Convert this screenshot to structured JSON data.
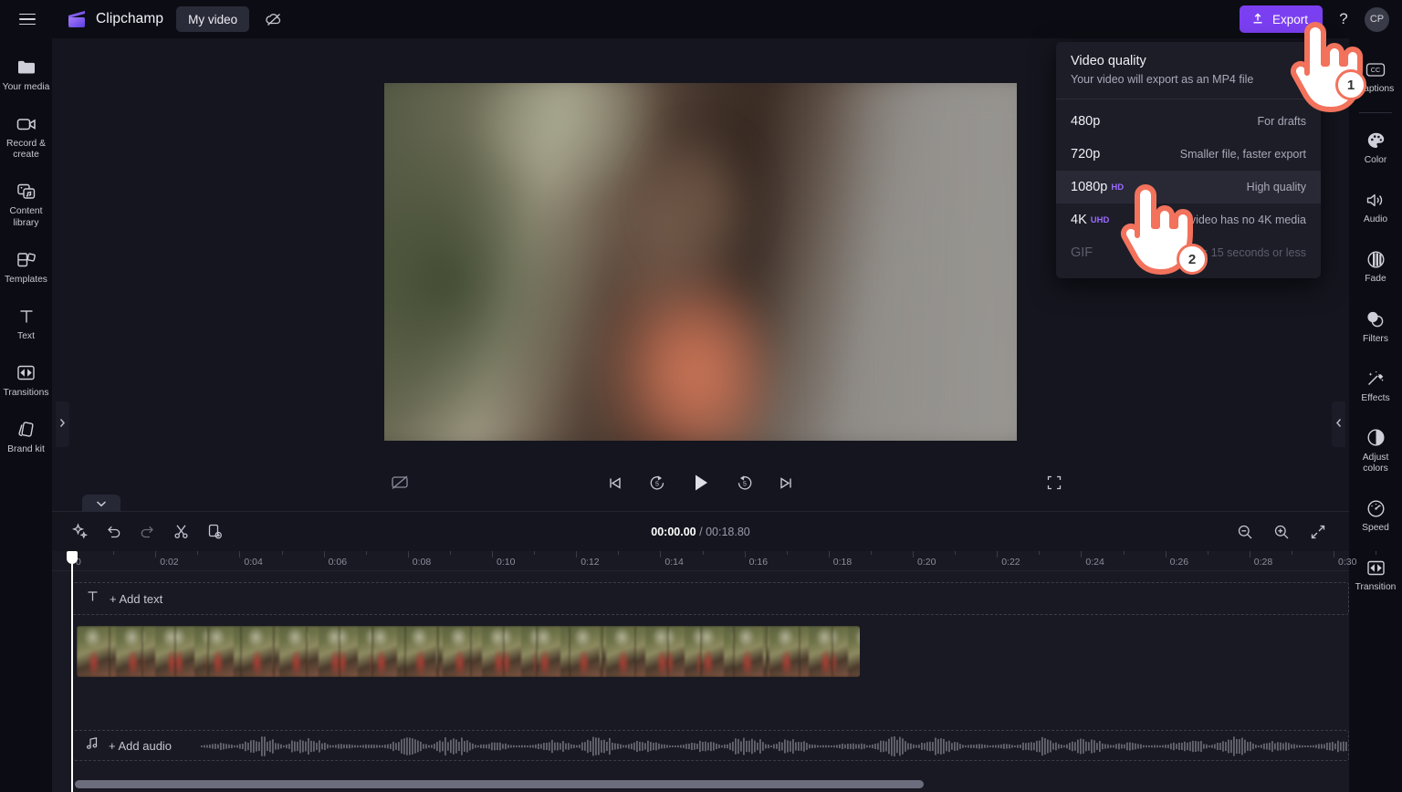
{
  "app": {
    "brand_name": "Clipchamp",
    "project_name": "My video",
    "menu_icon": "hamburger-icon",
    "cloud_icon": "cloud-off-icon",
    "logo_icon": "clipchamp-logo-icon"
  },
  "topbar": {
    "export_label": "Export",
    "export_icon": "upload-arrow-icon",
    "export_color": "#7b3ff2",
    "help_label": "?",
    "avatar_initials": "CP"
  },
  "left_sidebar": {
    "items": [
      {
        "label": "Your media",
        "icon": "media-folder-icon"
      },
      {
        "label": "Record & create",
        "icon": "video-camera-icon"
      },
      {
        "label": "Content library",
        "icon": "content-library-icon"
      },
      {
        "label": "Templates",
        "icon": "templates-grid-icon"
      },
      {
        "label": "Text",
        "icon": "text-t-icon"
      },
      {
        "label": "Transitions",
        "icon": "transitions-icon"
      },
      {
        "label": "Brand kit",
        "icon": "brand-kit-icon"
      }
    ]
  },
  "right_sidebar": {
    "items": [
      {
        "label": "Captions",
        "icon": "closed-captions-icon"
      },
      {
        "label": "Color",
        "icon": "palette-icon"
      },
      {
        "label": "Audio",
        "icon": "speaker-icon"
      },
      {
        "label": "Fade",
        "icon": "fade-icon"
      },
      {
        "label": "Filters",
        "icon": "filters-circles-icon"
      },
      {
        "label": "Effects",
        "icon": "magic-wand-icon"
      },
      {
        "label": "Adjust colors",
        "icon": "half-circle-icon"
      },
      {
        "label": "Speed",
        "icon": "speedometer-icon"
      },
      {
        "label": "Transition",
        "icon": "transitions-icon"
      }
    ]
  },
  "export_dropdown": {
    "title": "Video quality",
    "subtitle": "Your video will export as an MP4 file",
    "options": [
      {
        "name": "480p",
        "badge": "",
        "desc": "For drafts",
        "highlighted": false,
        "disabled": false
      },
      {
        "name": "720p",
        "badge": "",
        "desc": "Smaller file, faster export",
        "highlighted": false,
        "disabled": false
      },
      {
        "name": "1080p",
        "badge": "HD",
        "desc": "High quality",
        "highlighted": true,
        "disabled": false
      },
      {
        "name": "4K",
        "badge": "UHD",
        "desc": "Your video has no 4K media",
        "highlighted": false,
        "disabled": false
      },
      {
        "name": "GIF",
        "badge": "",
        "desc": "For videos 15 seconds or less",
        "highlighted": false,
        "disabled": true
      }
    ],
    "badge_color": "#9b6bff"
  },
  "player": {
    "controls": [
      {
        "icon": "skip-to-start-icon"
      },
      {
        "icon": "rewind-5-icon"
      },
      {
        "icon": "play-icon"
      },
      {
        "icon": "forward-5-icon"
      },
      {
        "icon": "skip-to-end-icon"
      }
    ],
    "captions_toggle_icon": "captions-off-icon",
    "fullscreen_icon": "fullscreen-icon"
  },
  "timeline": {
    "tools": [
      {
        "icon": "magic-sparkle-icon"
      },
      {
        "icon": "undo-icon"
      },
      {
        "icon": "redo-icon"
      },
      {
        "icon": "scissors-split-icon"
      },
      {
        "icon": "duplicate-icon"
      }
    ],
    "current_time": "00:00.00",
    "separator": "/",
    "total_time": "00:18.80",
    "zoom_controls": [
      {
        "icon": "zoom-out-icon"
      },
      {
        "icon": "zoom-in-icon"
      },
      {
        "icon": "fit-to-screen-icon"
      }
    ],
    "collapse_chevron_icon": "chevron-down-icon",
    "ruler_ticks": [
      "0:00",
      "0:02",
      "0:04",
      "0:06",
      "0:08",
      "0:10",
      "0:12",
      "0:14",
      "0:16",
      "0:18",
      "0:20",
      "0:22",
      "0:24",
      "0:26",
      "0:28",
      "0:30"
    ],
    "add_text_label": "+ Add text",
    "add_text_icon": "text-t-icon",
    "add_audio_label": "+ Add audio",
    "add_audio_icon": "music-note-icon"
  },
  "panels": {
    "left_collapse_icon": "chevron-right-icon",
    "right_collapse_icon": "chevron-left-icon"
  },
  "callouts": [
    {
      "step": "1"
    },
    {
      "step": "2"
    }
  ]
}
